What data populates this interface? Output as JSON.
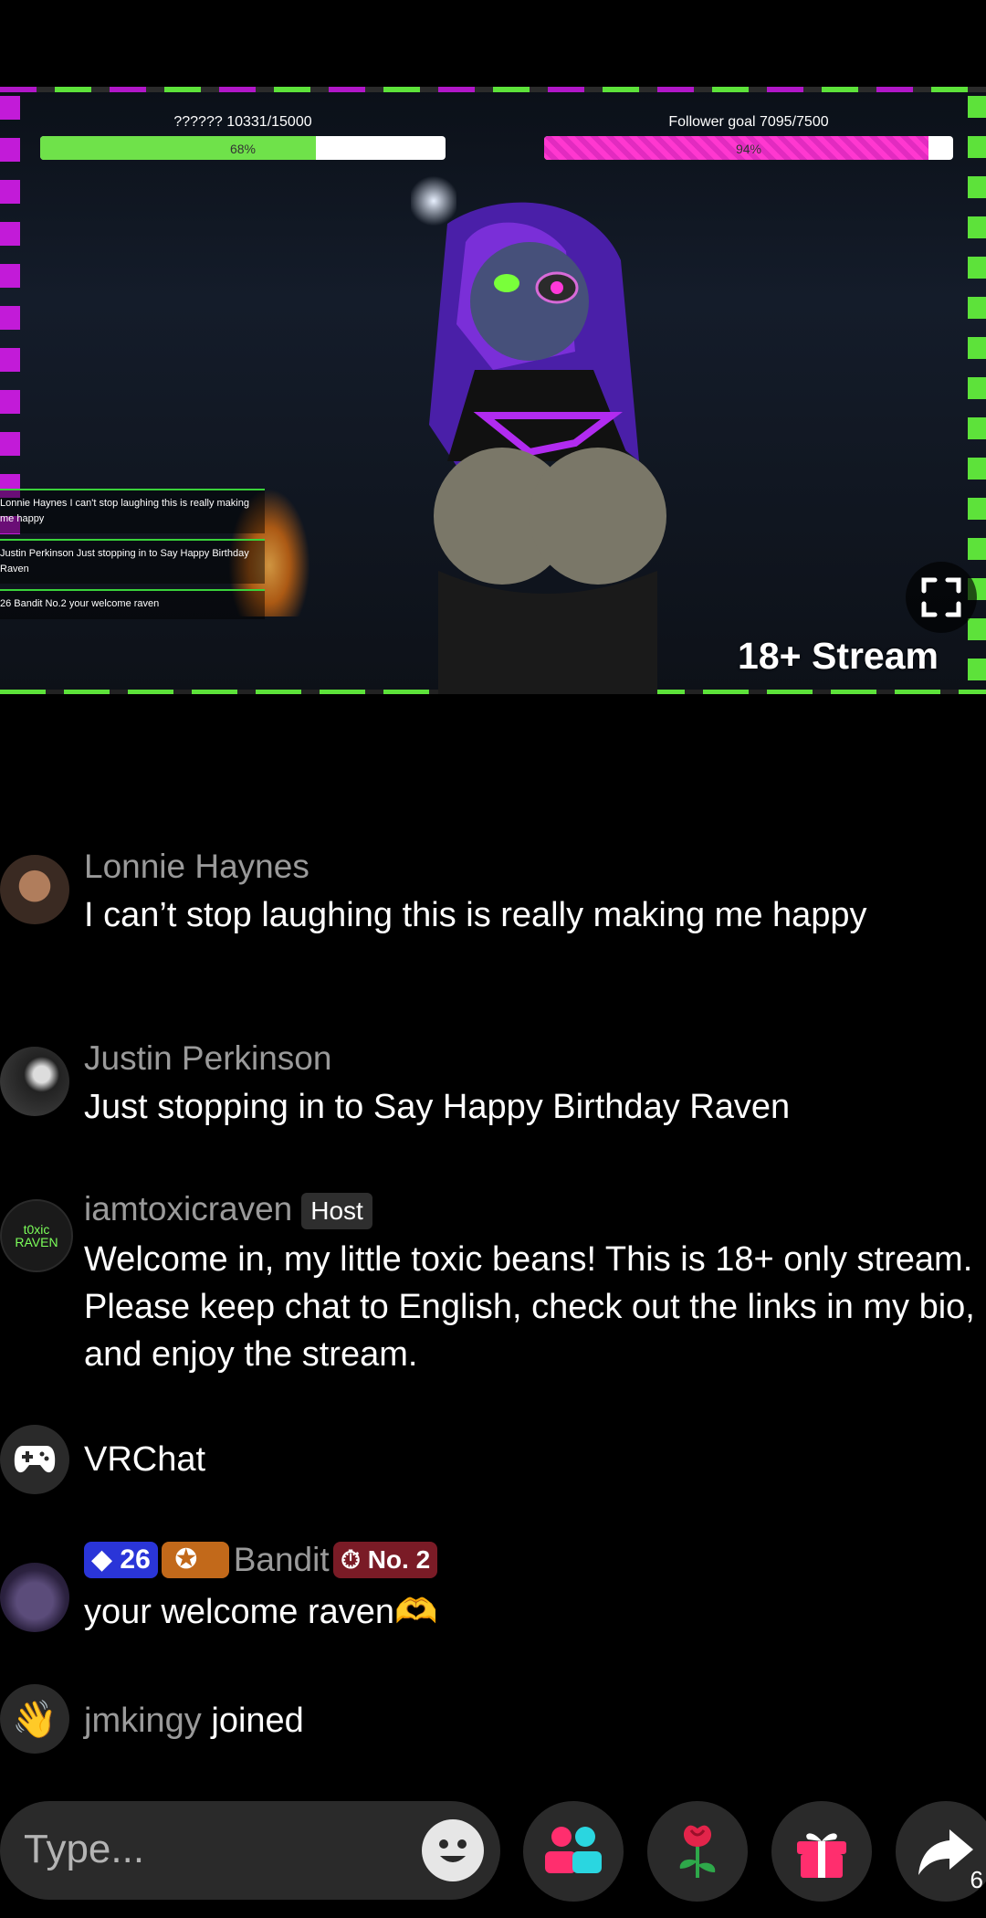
{
  "stream": {
    "goals": [
      {
        "label": "?????? 10331/15000",
        "pct": "68%",
        "fill": 0.68,
        "color": "#6fe24a"
      },
      {
        "label": "Follower goal 7095/7500",
        "pct": "94%",
        "fill": 0.94,
        "color": "#ff38d0"
      }
    ],
    "overlay_chat": [
      "Lonnie Haynes I can't stop laughing this is really making me happy",
      "Justin Perkinson Just stopping in to Say Happy Birthday Raven",
      "26 Bandit No.2 your welcome raven"
    ],
    "badge": "18+ Stream",
    "fullscreen_icon": "fullscreen-icon"
  },
  "chat": {
    "messages": [
      {
        "name": "Lonnie Haynes",
        "text": "I can’t stop laughing this is really making me happy"
      },
      {
        "name": "Justin Perkinson",
        "text": "Just stopping in to Say Happy Birthday Raven"
      },
      {
        "name": "iamtoxicraven",
        "host_tag": "Host",
        "avatar_text": "t0xic RAVEN",
        "text": "Welcome in, my little toxic beans! This is 18+ only stream. Please keep chat to English, check out the links in my bio, and enjoy the stream."
      },
      {
        "name": "VRChat",
        "icon": "gamepad-icon"
      },
      {
        "name": "Bandit",
        "gem_level": "26",
        "rank": "No. 2",
        "text": "your welcome raven🫶"
      },
      {
        "name": "jmkingy",
        "action": "joined",
        "icon": "wave-icon"
      }
    ]
  },
  "bottom_bar": {
    "placeholder": "Type...",
    "share_count": "6"
  },
  "colors": {
    "accent_green": "#5de23a",
    "accent_magenta": "#c21bd8",
    "name_gray": "#9a9a9a",
    "input_bg": "#2a2a2a"
  }
}
